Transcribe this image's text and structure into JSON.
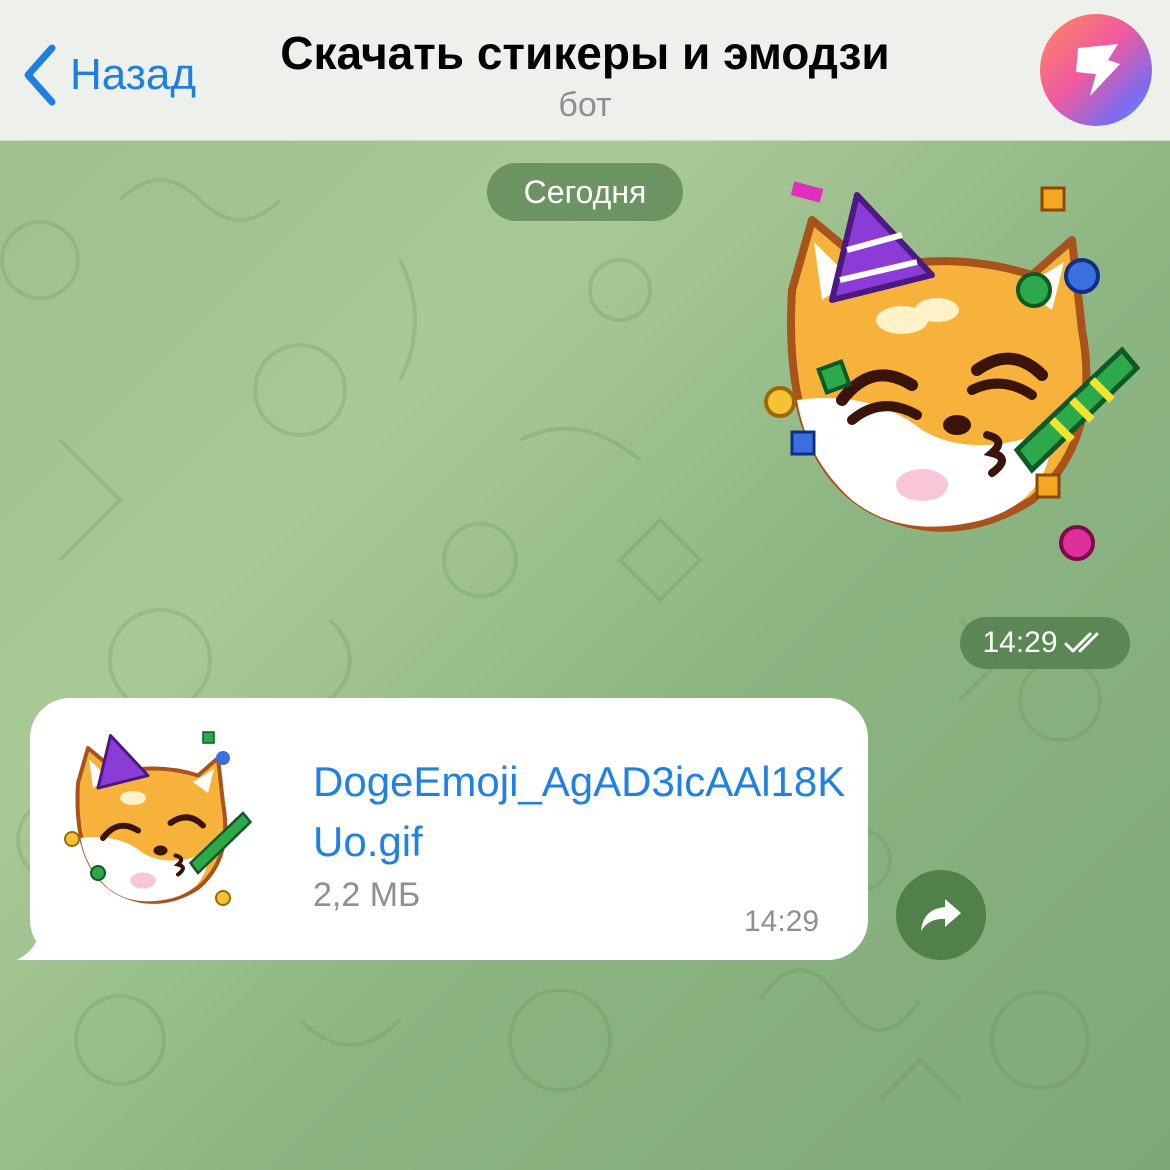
{
  "header": {
    "back_label": "Назад",
    "title": "Скачать стикеры и эмодзи",
    "subtitle": "бот"
  },
  "chat": {
    "date_label": "Сегодня",
    "sticker_message": {
      "time": "14:29",
      "status": "read"
    },
    "file_message": {
      "file_name": "DogeEmoji_AgAD3icAAl18KUo.gif",
      "file_size": "2,2 МБ",
      "time": "14:29"
    }
  },
  "colors": {
    "accent": "#1f7fe0",
    "chat_background": "#9dbf8e",
    "pill_background": "#588250"
  }
}
